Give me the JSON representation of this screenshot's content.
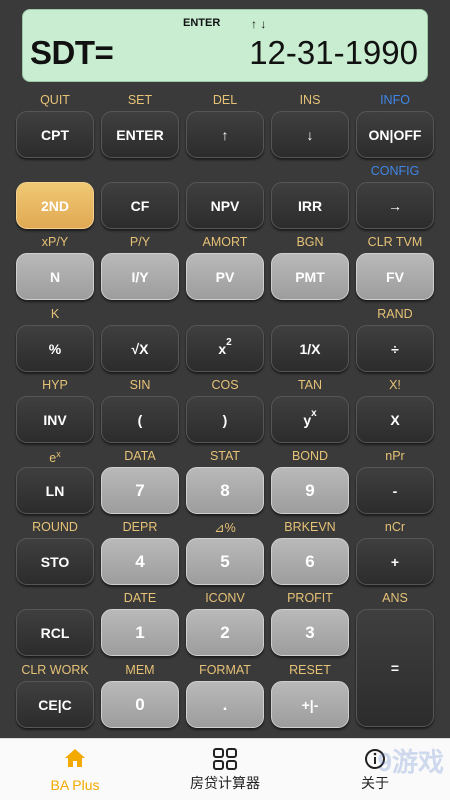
{
  "display": {
    "indicator_enter": "ENTER",
    "indicator_arrows": "↑ ↓",
    "label": "SDT=",
    "value": "12-31-1990"
  },
  "rows": [
    {
      "labels": [
        "QUIT",
        "SET",
        "DEL",
        "INS",
        "INFO"
      ],
      "keys": [
        "CPT",
        "ENTER",
        "↑",
        "↓",
        "ON|OFF"
      ]
    },
    {
      "labels": [
        "",
        "",
        "",
        "",
        "CONFIG"
      ],
      "keys": [
        "2ND",
        "CF",
        "NPV",
        "IRR",
        "→"
      ]
    },
    {
      "labels": [
        "xP/Y",
        "P/Y",
        "AMORT",
        "BGN",
        "CLR TVM"
      ],
      "keys": [
        "N",
        "I/Y",
        "PV",
        "PMT",
        "FV"
      ]
    },
    {
      "labels": [
        "K",
        "",
        "",
        "",
        "RAND"
      ],
      "keys": [
        "%",
        "√X",
        "x",
        "1/X",
        "÷"
      ],
      "key_sup": [
        "",
        "",
        "2",
        "",
        ""
      ]
    },
    {
      "labels": [
        "HYP",
        "SIN",
        "COS",
        "TAN",
        "X!"
      ],
      "keys": [
        "INV",
        "(",
        ")",
        "y",
        "X"
      ],
      "key_sup": [
        "",
        "",
        "",
        "x",
        ""
      ]
    },
    {
      "labels": [
        "e",
        "DATA",
        "STAT",
        "BOND",
        "nPr"
      ],
      "label_sup": [
        "x",
        "",
        "",
        "",
        ""
      ],
      "keys": [
        "LN",
        "7",
        "8",
        "9",
        "-"
      ]
    },
    {
      "labels": [
        "ROUND",
        "DEPR",
        "⊿%",
        "BRKEVN",
        "nCr"
      ],
      "keys": [
        "STO",
        "4",
        "5",
        "6",
        "+"
      ]
    },
    {
      "labels": [
        "",
        "DATE",
        "ICONV",
        "PROFIT",
        "ANS"
      ],
      "keys": [
        "RCL",
        "1",
        "2",
        "3",
        "="
      ]
    },
    {
      "labels": [
        "CLR WORK",
        "MEM",
        "FORMAT",
        "RESET",
        ""
      ],
      "keys": [
        "CE|C",
        "0",
        ".",
        "+|-",
        ""
      ]
    }
  ],
  "tabs": [
    {
      "label": "BA Plus",
      "icon": "home-icon"
    },
    {
      "label": "房贷计算器",
      "icon": "grid-icon"
    },
    {
      "label": "关于",
      "icon": "info-icon"
    }
  ],
  "watermark": "9游戏",
  "colors": {
    "accent": "#f2a900",
    "label": "#e6c277",
    "info_label": "#3f86e8",
    "display_bg": "#c8edd1"
  }
}
